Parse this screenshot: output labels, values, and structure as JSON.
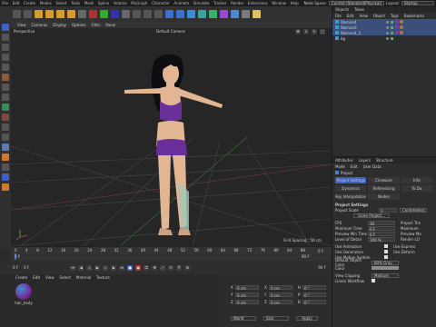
{
  "menubar": {
    "items": [
      "File",
      "Edit",
      "Create",
      "Modes",
      "Select",
      "Tools",
      "Mesh",
      "Spline",
      "Volume",
      "MoGraph",
      "Character",
      "Animate",
      "Simulate",
      "Tracker",
      "Render",
      "Extensions",
      "Window",
      "Help"
    ],
    "node_space_label": "Node Space:",
    "node_space_value": "Current (Standard/Physical)",
    "layout_label": "Layout:",
    "layout_value": "Startup"
  },
  "toolbar": {
    "icons": [
      "undo-icon",
      "redo-icon",
      "live-select-icon",
      "move-icon",
      "scale-icon",
      "rotate-icon",
      "recent-tools-icon",
      "lock-x-icon",
      "lock-y-icon",
      "lock-z-icon",
      "coord-system-icon",
      "render-view-icon",
      "render-to-picture-viewer-icon",
      "render-settings-icon",
      "cube-icon",
      "pen-icon",
      "subdivision-icon",
      "array-icon",
      "mograph-cloner-icon",
      "deformer-icon",
      "floor-icon",
      "camera-icon",
      "light-icon"
    ]
  },
  "viewport": {
    "menu": [
      "View",
      "Cameras",
      "Display",
      "Options",
      "Filter",
      "Panel"
    ],
    "label": "Perspective",
    "camera": "Default Camera",
    "grid_spacing": "Grid Spacing : 50 cm"
  },
  "timeline": {
    "ticks": [
      "0",
      "4",
      "8",
      "12",
      "16",
      "20",
      "24",
      "28",
      "32",
      "36",
      "40",
      "44",
      "48",
      "52",
      "56",
      "60",
      "64",
      "68",
      "72",
      "76",
      "80",
      "84",
      "88"
    ],
    "start": "0 F",
    "current": "0 F",
    "end": "90 F",
    "end2": "90 F",
    "frame_right": "0 F"
  },
  "materials": {
    "menu": [
      "Create",
      "Edit",
      "View",
      "Select",
      "Material",
      "Texture"
    ],
    "items": [
      "hair_body"
    ]
  },
  "coords": {
    "rows": [
      {
        "a": "X",
        "av": "0 cm",
        "b": "X",
        "bv": "0 cm",
        "c": "H",
        "cv": "0 °"
      },
      {
        "a": "Y",
        "av": "0 cm",
        "b": "Y",
        "bv": "0 cm",
        "c": "P",
        "cv": "0 °"
      },
      {
        "a": "Z",
        "av": "0 cm",
        "b": "Z",
        "bv": "0 cm",
        "c": "B",
        "cv": "0 °"
      }
    ],
    "mode1": "World",
    "mode2": "Size",
    "apply": "Apply"
  },
  "objects": {
    "tabs": [
      "Objects",
      "Takes"
    ],
    "menu": [
      "File",
      "Edit",
      "View",
      "Object",
      "Tags",
      "Bookmarks"
    ],
    "items": [
      {
        "name": "Woman4"
      },
      {
        "name": "Woman0"
      },
      {
        "name": "Woman4_2"
      },
      {
        "name": "bg"
      }
    ]
  },
  "attributes": {
    "tabs": [
      "Attributes",
      "Layers",
      "Structure"
    ],
    "menu": [
      "Mode",
      "Edit",
      "User Data"
    ],
    "object": "Project",
    "subtabs": [
      "Project Settings",
      "Cineware",
      "Info",
      "Dynamics",
      "Referencing",
      "To Do"
    ],
    "subtabs2": [
      "Key Interpolation",
      "Nodes"
    ],
    "section": "Project Settings",
    "scale_label": "Project Scale",
    "scale_value": "1",
    "scale_unit": "Centimeters",
    "scale_button": "Scale Project...",
    "left": [
      {
        "k": "FPS",
        "v": "30"
      },
      {
        "k": "Minimum Time",
        "v": "0 F"
      },
      {
        "k": "Preview Min Time",
        "v": "0 F"
      },
      {
        "k": "Level of Detail",
        "v": "100 %"
      }
    ],
    "right": [
      "Project Tim",
      "Maximum",
      "Preview Ma",
      "Render LO"
    ],
    "checks": [
      {
        "k": "Use Animation"
      },
      {
        "k": "Use Generators"
      },
      {
        "k": "Use Motion System"
      }
    ],
    "checks_right": [
      "Use Express",
      "Use Deform"
    ],
    "default_color_label": "Default Object Color",
    "default_color_value": "60% Gray",
    "color_label": "Color",
    "view_clipping_label": "View Clipping",
    "view_clipping_value": "Medium",
    "linear_workflow_label": "Linear Workflow"
  },
  "colors": {
    "bg": "#2b2b2b",
    "accent": "#3b62c4",
    "selection": "#3a4f7a"
  }
}
